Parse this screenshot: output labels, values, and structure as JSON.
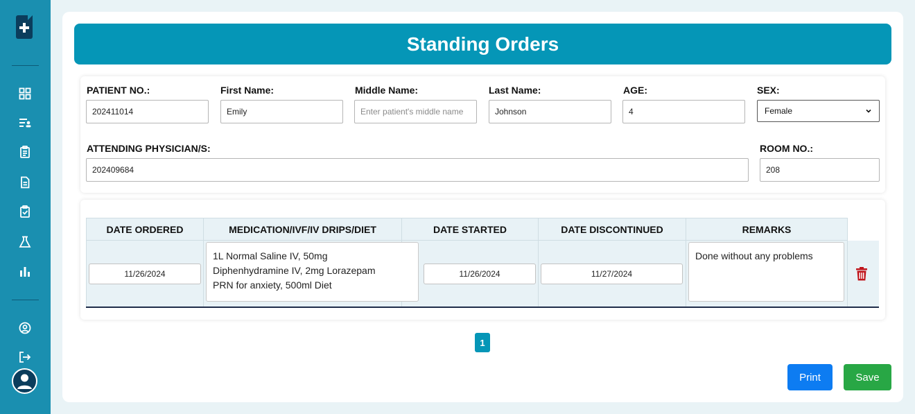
{
  "sidebar": {
    "icons": [
      "document-plus-icon",
      "dashboard-icon",
      "patient-list-icon",
      "clipboard-icon",
      "file-icon",
      "clipboard-check-icon",
      "flask-icon",
      "bar-chart-icon",
      "user-circle-icon",
      "logout-icon",
      "avatar-icon"
    ]
  },
  "header": {
    "title": "Standing Orders"
  },
  "patient": {
    "patient_no_label": "PATIENT NO.:",
    "patient_no": "202411014",
    "first_name_label": "First Name:",
    "first_name": "Emily",
    "middle_name_label": "Middle Name:",
    "middle_name_placeholder": "Enter patient's middle name",
    "last_name_label": "Last Name:",
    "last_name": "Johnson",
    "age_label": "AGE:",
    "age": "4",
    "sex_label": "SEX:",
    "sex": "Female",
    "physician_label": "ATTENDING PHYSICIAN/S:",
    "physician": "202409684",
    "room_label": "ROOM NO.:",
    "room": "208"
  },
  "orders": {
    "columns": [
      "DATE ORDERED",
      "MEDICATION/IVF/IV DRIPS/DIET",
      "DATE STARTED",
      "DATE DISCONTINUED",
      "REMARKS"
    ],
    "rows": [
      {
        "date_ordered": "11/26/2024",
        "medication": "1L Normal Saline IV, 50mg\nDiphenhydramine IV, 2mg Lorazepam\nPRN for anxiety, 500ml Diet",
        "date_started": "11/26/2024",
        "date_discontinued": "11/27/2024",
        "remarks": "Done without any problems"
      }
    ]
  },
  "pagination": {
    "current": "1"
  },
  "actions": {
    "print_label": "Print",
    "save_label": "Save"
  },
  "colors": {
    "sidebar": "#1a8fb0",
    "accent": "#0596b7",
    "print": "#0d7cf2",
    "save": "#28a745",
    "delete": "#c0161d"
  }
}
